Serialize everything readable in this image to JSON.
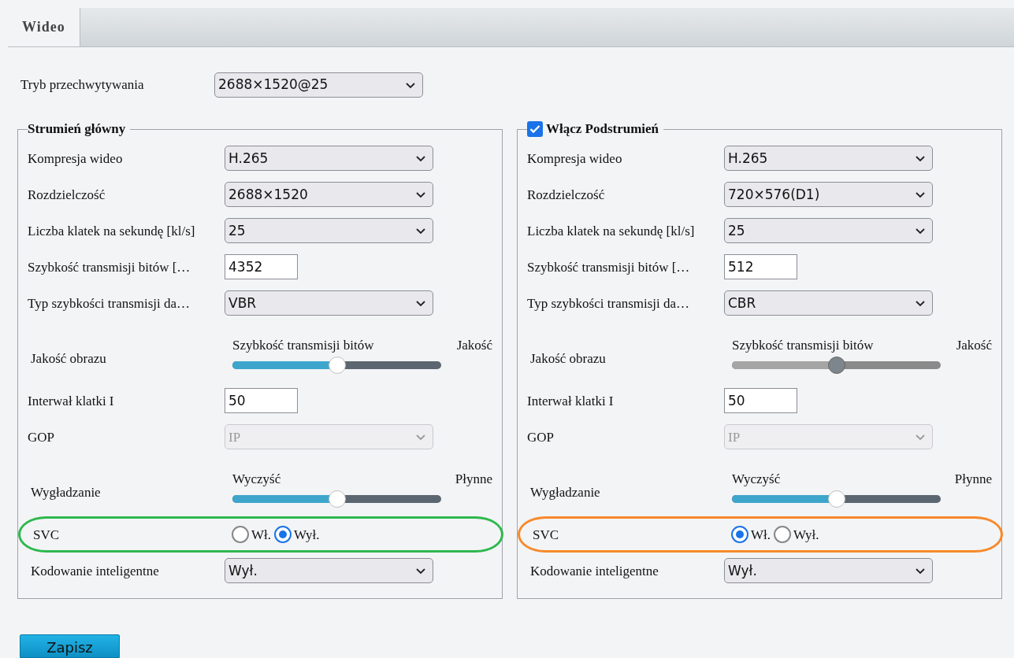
{
  "tabs": [
    {
      "label": "Wideo",
      "selected": true
    }
  ],
  "capture_mode": {
    "label": "Tryb przechwytywania",
    "value": "2688×1520@25"
  },
  "streams": [
    {
      "title": "Strumień główny",
      "rows": [
        {
          "kind": "select",
          "label": "Kompresja wideo",
          "value": "H.265",
          "disabled": false
        },
        {
          "kind": "select",
          "label": "Rozdzielczość",
          "value": "2688×1520",
          "disabled": false
        },
        {
          "kind": "select",
          "label": "Liczba klatek na sekundę [kl/s]",
          "value": "25",
          "disabled": false
        },
        {
          "kind": "input",
          "label": "Szybkość transmisji bitów […",
          "value": "4352"
        },
        {
          "kind": "select",
          "label": "Typ szybkości transmisji da…",
          "value": "VBR",
          "disabled": false
        },
        {
          "kind": "slider",
          "label": "Jakość obrazu",
          "left": "Szybkość transmisji bitów",
          "right": "Jakość",
          "level": 0.5,
          "disabled": false
        },
        {
          "kind": "input",
          "label": "Interwał klatki I",
          "value": "50"
        },
        {
          "kind": "select",
          "label": "GOP",
          "value": "IP",
          "disabled": true
        },
        {
          "kind": "slider",
          "label": "Wygładzanie",
          "left": "Wyczyść",
          "right": "Płynne",
          "level": 0.5,
          "disabled": false
        },
        {
          "kind": "radio",
          "label": "SVC",
          "color": "#2db84d",
          "options": [
            {
              "label": "Wł.",
              "selected": false
            },
            {
              "label": "Wył.",
              "selected": true
            }
          ]
        },
        {
          "kind": "select",
          "label": "Kodowanie inteligentne",
          "value": "Wył.",
          "disabled": false
        }
      ]
    },
    {
      "title": "Włącz Podstrumień",
      "checked": true,
      "rows": [
        {
          "kind": "select",
          "label": "Kompresja wideo",
          "value": "H.265",
          "disabled": false
        },
        {
          "kind": "select",
          "label": "Rozdzielczość",
          "value": "720×576(D1)",
          "disabled": false
        },
        {
          "kind": "select",
          "label": "Liczba klatek na sekundę [kl/s]",
          "value": "25",
          "disabled": false
        },
        {
          "kind": "input",
          "label": "Szybkość transmisji bitów […",
          "value": "512"
        },
        {
          "kind": "select",
          "label": "Typ szybkości transmisji da…",
          "value": "CBR",
          "disabled": false
        },
        {
          "kind": "slider",
          "label": "Jakość obrazu",
          "left": "Szybkość transmisji bitów",
          "right": "Jakość",
          "level": 0.5,
          "disabled": true
        },
        {
          "kind": "input",
          "label": "Interwał klatki I",
          "value": "50"
        },
        {
          "kind": "select",
          "label": "GOP",
          "value": "IP",
          "disabled": true
        },
        {
          "kind": "slider",
          "label": "Wygładzanie",
          "left": "Wyczyść",
          "right": "Płynne",
          "level": 0.5,
          "disabled": false
        },
        {
          "kind": "radio",
          "label": "SVC",
          "color": "#f7892a",
          "options": [
            {
              "label": "Wł.",
              "selected": true
            },
            {
              "label": "Wył.",
              "selected": false
            }
          ]
        },
        {
          "kind": "select",
          "label": "Kodowanie inteligentne",
          "value": "Wył.",
          "disabled": false
        }
      ]
    }
  ],
  "save_button": "Zapisz"
}
